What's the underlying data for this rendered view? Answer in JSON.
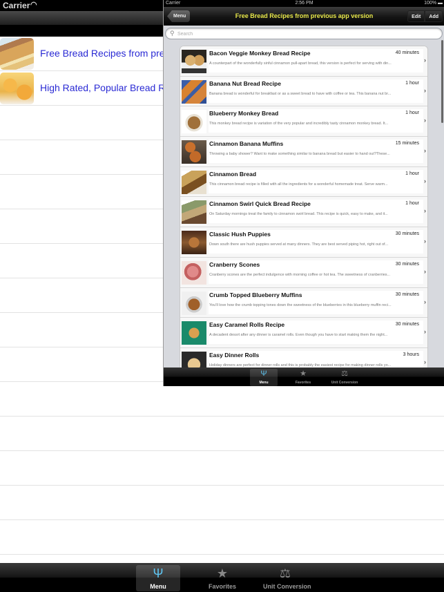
{
  "background_screen": {
    "status_bar": {
      "carrier": "Carrier"
    },
    "menu_items": [
      {
        "label": "Free Bread Recipes from previous app version",
        "thumbnail": "bread-loaf-image"
      },
      {
        "label": "High Rated, Popular Bread Recipes",
        "thumbnail": "cornbread-image"
      }
    ],
    "empty_rows": 13,
    "tab_bar": [
      {
        "label": "Menu",
        "icon": "fork-icon",
        "active": true
      },
      {
        "label": "Favorites",
        "icon": "star-icon",
        "active": false
      },
      {
        "label": "Unit Conversion",
        "icon": "scale-icon",
        "active": false
      }
    ]
  },
  "detail_screen": {
    "status_bar": {
      "carrier": "Carrier",
      "time": "2:56 PM",
      "battery": "100%"
    },
    "nav": {
      "back_label": "Menu",
      "title": "Free Bread Recipes from previous app version",
      "edit_label": "Edit",
      "add_label": "Add"
    },
    "search": {
      "placeholder": "Search",
      "value": ""
    },
    "recipes": [
      {
        "title": "Bacon Veggie Monkey Bread Recipe",
        "time": "40 minutes",
        "description": "A counterpart of the wonderfully sinful cinnamon pull-apart bread, this version is perfect for serving with din..."
      },
      {
        "title": "Banana Nut Bread Recipe",
        "time": "1 hour",
        "description": "Banana bread is wonderful for breakfast or as a sweet bread to have with coffee or tea. This banana nut br..."
      },
      {
        "title": "Blueberry Monkey Bread",
        "time": "1 hour",
        "description": "This monkey bread recipe is variation of the very popular and incredibly tasty cinnamon monkey bread. It..."
      },
      {
        "title": "Cinnamon Banana Muffins",
        "time": "15 minutes",
        "description": "Throwing a baby shower? Want to make something similar to banana bread but easier to hand out?These..."
      },
      {
        "title": "Cinnamon Bread",
        "time": "1 hour",
        "description": "This cinnamon bread recipe is filled with all the ingredients for a wonderful homemade treat. Serve warm..."
      },
      {
        "title": "Cinnamon Swirl Quick Bread Recipe",
        "time": "1 hour",
        "description": "On Saturday mornings treat the family to cinnamon swirl bread. This recipe is quick, easy to make, and it..."
      },
      {
        "title": "Classic Hush Puppies",
        "time": "30 minutes",
        "description": "Down south there are hush puppies served at many dinners. They are best served piping hot, right out of..."
      },
      {
        "title": "Cranberry Scones",
        "time": "30 minutes",
        "description": "Cranberry scones are the perfect indulgence with morning coffee or hot tea. The sweetness of cranberries..."
      },
      {
        "title": "Crumb Topped Blueberry Muffins",
        "time": "30 minutes",
        "description": "You'll love how the crumb topping tones down the sweetness of the blueberries in this blueberry muffin reci..."
      },
      {
        "title": "Easy Caramel Rolls Recipe",
        "time": "30 minutes",
        "description": "A decadent dessrt after any dinner is caramel rolls. Even though you have to start making them the night..."
      },
      {
        "title": "Easy Dinner Rolls",
        "time": "3 hours",
        "description": "Holiday dinners are perfect for dinner rolls and this is probably the easiest recipe for making dinner rolls yo..."
      }
    ],
    "tab_bar": [
      {
        "label": "Menu",
        "icon": "fork-icon",
        "active": true
      },
      {
        "label": "Favorites",
        "icon": "star-icon",
        "active": false
      },
      {
        "label": "Unit Conversion",
        "icon": "scale-icon",
        "active": false
      }
    ]
  },
  "icons": {
    "chevron": "›",
    "search": "⚲",
    "fork": "Ψ",
    "star": "★",
    "scale": "⚖",
    "wifi": "◠",
    "battery": "▬"
  },
  "colors": {
    "link_blue": "#2a2ad4",
    "nav_title_yellow": "#e8e84a",
    "tab_active_blue": "#5ec4f0"
  }
}
